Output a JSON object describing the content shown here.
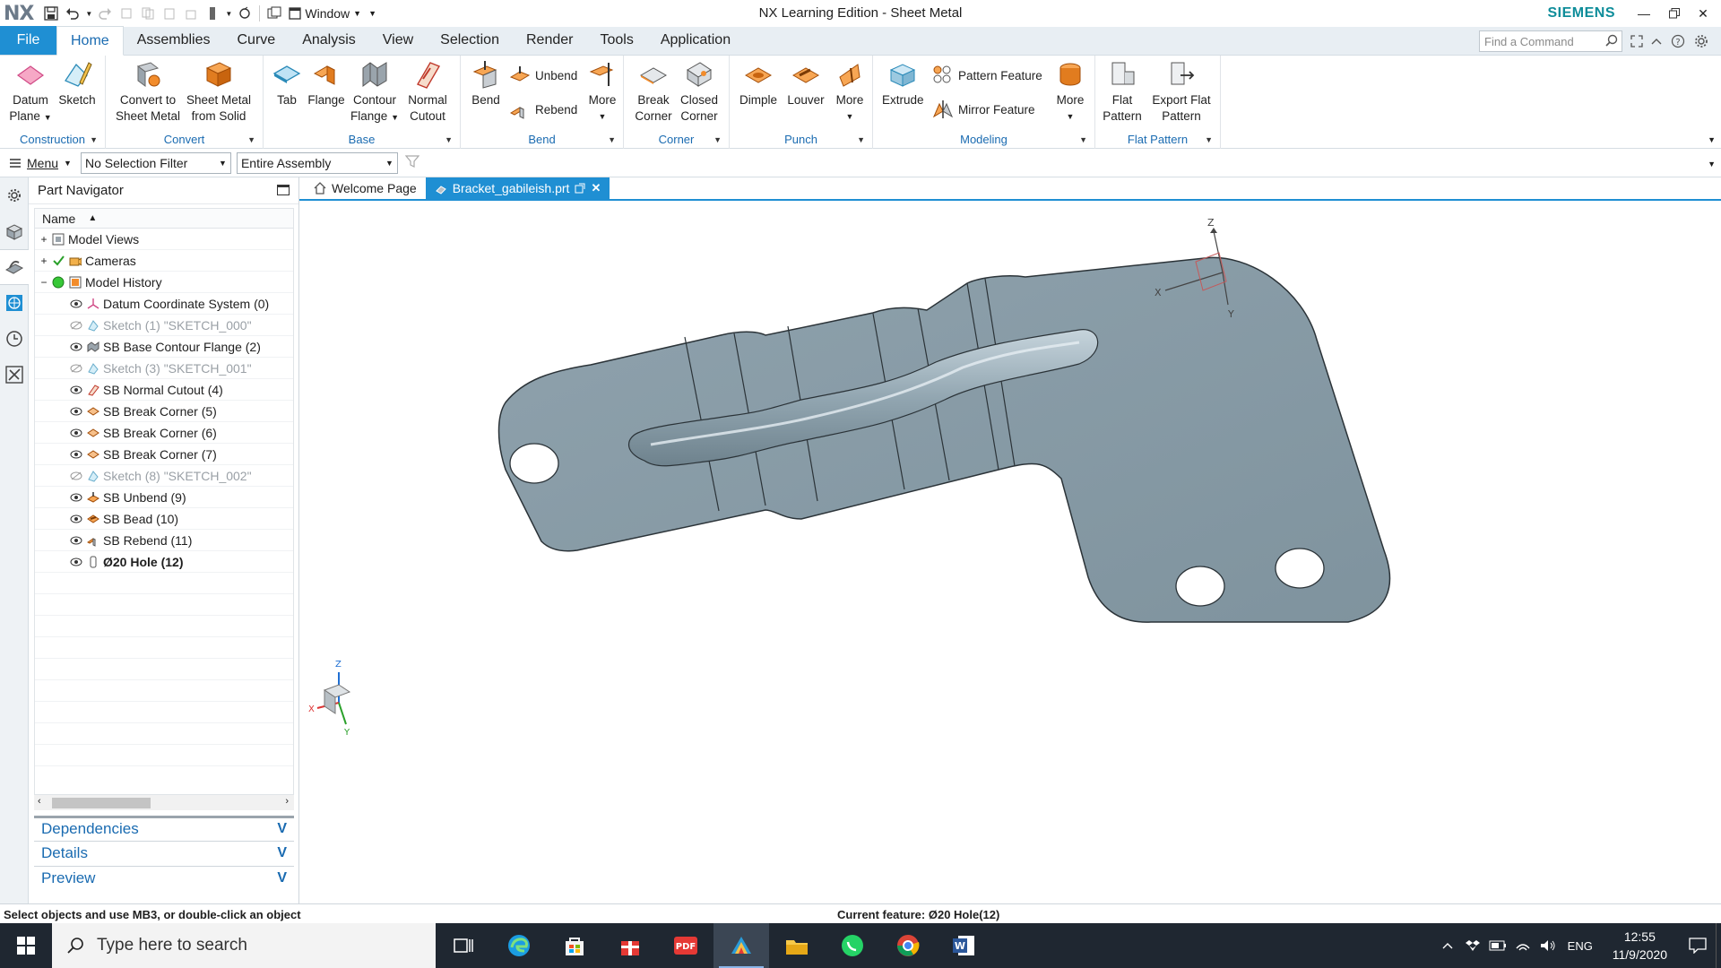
{
  "app": {
    "logo": "NX",
    "title": "NX Learning Edition - Sheet Metal",
    "brand": "SIEMENS",
    "window_menu": "Window"
  },
  "ribbon_tabs": [
    "File",
    "Home",
    "Assemblies",
    "Curve",
    "Analysis",
    "View",
    "Selection",
    "Render",
    "Tools",
    "Application"
  ],
  "active_tab": "Home",
  "find_command_placeholder": "Find a Command",
  "ribbon": {
    "construction": {
      "label": "Construction",
      "datum_plane_1": "Datum",
      "datum_plane_2": "Plane",
      "sketch": "Sketch"
    },
    "convert": {
      "label": "Convert",
      "convert_1": "Convert to",
      "convert_2": "Sheet Metal",
      "smfs_1": "Sheet Metal",
      "smfs_2": "from Solid"
    },
    "base": {
      "label": "Base",
      "tab": "Tab",
      "flange": "Flange",
      "contour_1": "Contour",
      "contour_2": "Flange",
      "normal_1": "Normal",
      "normal_2": "Cutout"
    },
    "bend": {
      "label": "Bend",
      "bend": "Bend",
      "unbend": "Unbend",
      "rebend": "Rebend",
      "more": "More"
    },
    "corner": {
      "label": "Corner",
      "break_1": "Break",
      "break_2": "Corner",
      "closed_1": "Closed",
      "closed_2": "Corner"
    },
    "punch": {
      "label": "Punch",
      "dimple": "Dimple",
      "louver": "Louver",
      "more": "More"
    },
    "modeling": {
      "label": "Modeling",
      "extrude": "Extrude",
      "pattern_feature": "Pattern Feature",
      "mirror_feature": "Mirror Feature",
      "more": "More"
    },
    "flat_pattern": {
      "label": "Flat Pattern",
      "flat_1": "Flat",
      "flat_2": "Pattern",
      "export_1": "Export Flat",
      "export_2": "Pattern"
    }
  },
  "selection_bar": {
    "menu": "Menu",
    "filter": "No Selection Filter",
    "scope": "Entire Assembly"
  },
  "navigator": {
    "title": "Part Navigator",
    "column": "Name",
    "top_nodes": [
      {
        "label": "Model Views",
        "expander": "+"
      },
      {
        "label": "Cameras",
        "expander": "+"
      },
      {
        "label": "Model History",
        "expander": "−"
      }
    ],
    "features": [
      {
        "label": "Datum Coordinate System (0)",
        "icon": "datum-csys-icon"
      },
      {
        "label": "Sketch (1) \"SKETCH_000\"",
        "icon": "sketch-icon"
      },
      {
        "label": "SB Base Contour Flange (2)",
        "icon": "contour-flange-icon"
      },
      {
        "label": "Sketch (3) \"SKETCH_001\"",
        "icon": "sketch-icon"
      },
      {
        "label": "SB Normal Cutout (4)",
        "icon": "normal-cutout-icon"
      },
      {
        "label": "SB Break Corner (5)",
        "icon": "break-corner-icon"
      },
      {
        "label": "SB Break Corner (6)",
        "icon": "break-corner-icon"
      },
      {
        "label": "SB Break Corner (7)",
        "icon": "break-corner-icon"
      },
      {
        "label": "Sketch (8) \"SKETCH_002\"",
        "icon": "sketch-icon"
      },
      {
        "label": "SB Unbend (9)",
        "icon": "unbend-icon"
      },
      {
        "label": "SB Bead (10)",
        "icon": "bead-icon"
      },
      {
        "label": "SB Rebend (11)",
        "icon": "rebend-icon"
      },
      {
        "label": "Ø20 Hole (12)",
        "icon": "hole-icon"
      }
    ],
    "panels": [
      "Dependencies",
      "Details",
      "Preview"
    ]
  },
  "doc_tabs": [
    "Welcome Page",
    "Bracket_gabileish.prt"
  ],
  "triad_axes": [
    "Z",
    "X",
    "Y"
  ],
  "status": {
    "prompt": "Select objects and use MB3, or double-click an object",
    "current_feature": "Current feature: Ø20 Hole(12)"
  },
  "taskbar": {
    "search_placeholder": "Type here to search",
    "lang": "ENG",
    "time": "12:55",
    "date": "11/9/2020"
  },
  "colors": {
    "accent": "#1f8fd3",
    "part": "#8fa3ae",
    "taskbar": "#1f2731"
  }
}
